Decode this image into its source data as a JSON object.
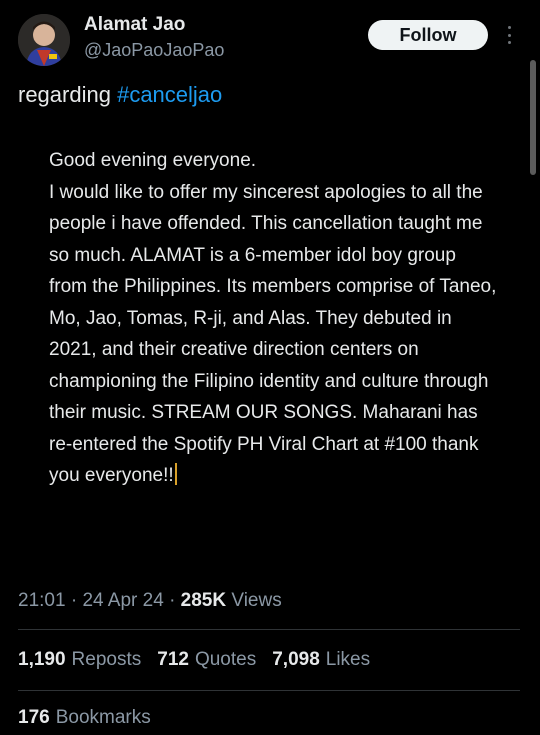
{
  "author": {
    "name": "Alamat Jao",
    "handle": "@JaoPaoJaoPao"
  },
  "follow_label": "Follow",
  "tweet": {
    "prefix": "regarding ",
    "hashtag": "#canceljao",
    "body": "Good evening everyone.\nI would like to offer my sincerest apologies to all the people i have offended. This cancellation taught me so much. ALAMAT is a 6-member idol boy group from the Philippines. Its members comprise of Taneo, Mo, Jao, Tomas, R-ji, and Alas. They debuted in 2021, and their creative direction centers on championing the Filipino identity and culture through their music. STREAM OUR SONGS. Maharani has re-entered the Spotify PH Viral Chart at #100 thank you everyone!!"
  },
  "meta": {
    "time": "21:01",
    "date": "24 Apr 24",
    "views_count": "285K",
    "views_label": "Views"
  },
  "stats": {
    "reposts_count": "1,190",
    "reposts_label": "Reposts",
    "quotes_count": "712",
    "quotes_label": "Quotes",
    "likes_count": "7,098",
    "likes_label": "Likes",
    "bookmarks_count": "176",
    "bookmarks_label": "Bookmarks"
  },
  "icons": [
    "avatar-image",
    "more-options-icon"
  ],
  "colors": {
    "background": "#000000",
    "text": "#e7e9ea",
    "muted": "#8b98a5",
    "link": "#1d9bf0",
    "follow_bg": "#eff3f4"
  }
}
